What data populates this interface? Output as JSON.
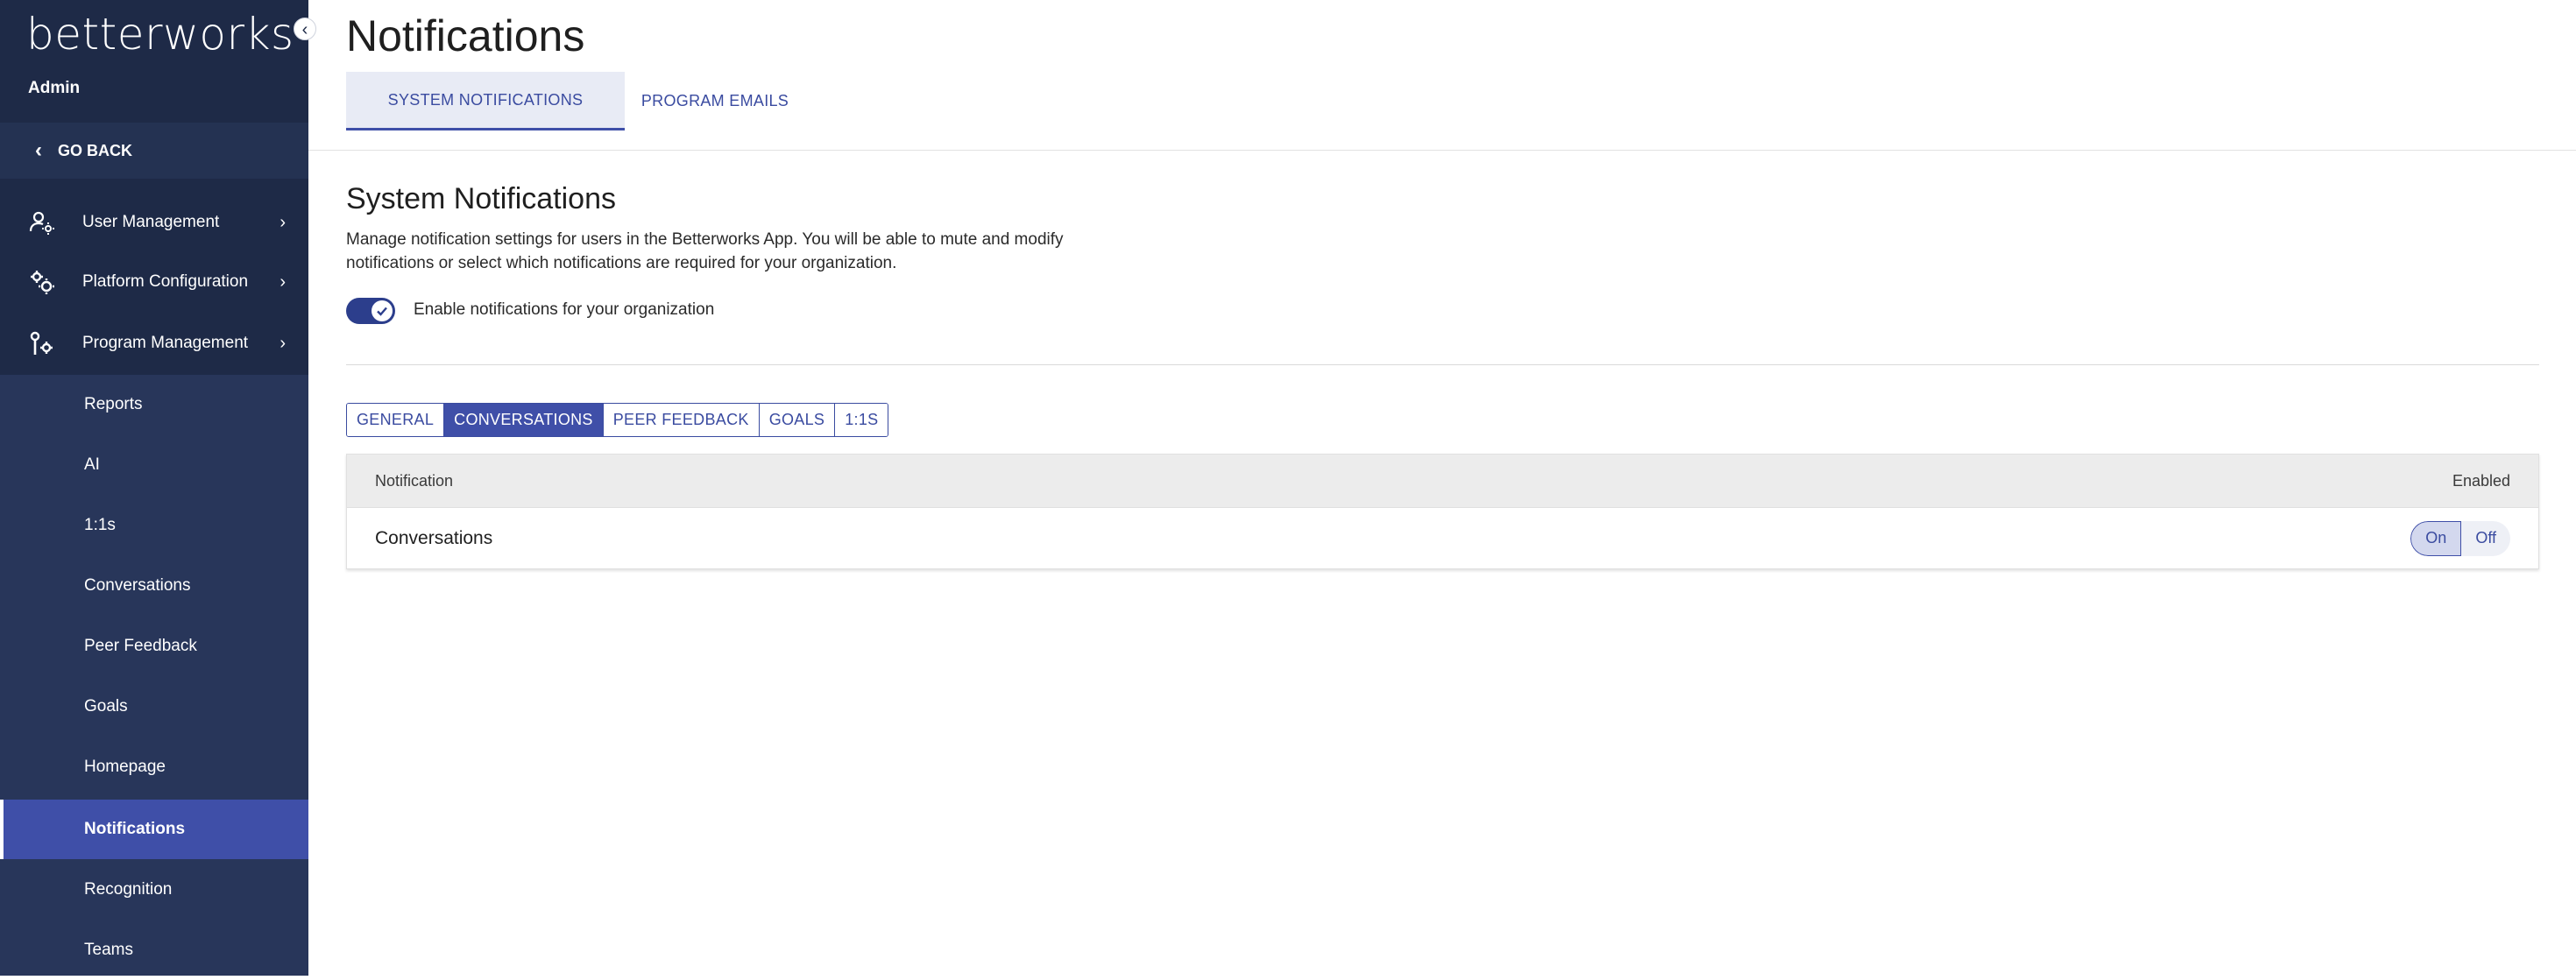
{
  "brand": {
    "logo_text": "betterworks"
  },
  "sidebar": {
    "role_label": "Admin",
    "go_back_label": "GO BACK",
    "sections": [
      {
        "label": "User Management",
        "icon": "user-settings-icon"
      },
      {
        "label": "Platform Configuration",
        "icon": "gears-icon"
      },
      {
        "label": "Program Management",
        "icon": "program-tools-icon"
      }
    ],
    "sub_items": [
      {
        "label": "Reports"
      },
      {
        "label": "AI"
      },
      {
        "label": "1:1s"
      },
      {
        "label": "Conversations"
      },
      {
        "label": "Peer Feedback"
      },
      {
        "label": "Goals"
      },
      {
        "label": "Homepage"
      },
      {
        "label": "Notifications",
        "active": true
      },
      {
        "label": "Recognition"
      },
      {
        "label": "Teams"
      }
    ]
  },
  "header": {
    "title": "Notifications",
    "tabs": [
      {
        "label": "SYSTEM NOTIFICATIONS",
        "active": true
      },
      {
        "label": "PROGRAM EMAILS",
        "active": false
      }
    ]
  },
  "content": {
    "section_title": "System Notifications",
    "description": "Manage notification settings for users in the Betterworks App. You will be able to mute and modify notifications or select which notifications are required for your organization.",
    "org_toggle": {
      "label": "Enable notifications for your organization",
      "enabled": true
    },
    "category_tabs": [
      {
        "label": "GENERAL",
        "active": false
      },
      {
        "label": "CONVERSATIONS",
        "active": true
      },
      {
        "label": "PEER FEEDBACK",
        "active": false
      },
      {
        "label": "GOALS",
        "active": false
      },
      {
        "label": "1:1S",
        "active": false
      }
    ],
    "table": {
      "col_notification": "Notification",
      "col_enabled": "Enabled",
      "rows": [
        {
          "label": "Conversations",
          "on_label": "On",
          "off_label": "Off",
          "value": "On"
        }
      ]
    }
  },
  "colors": {
    "sidebar_bg": "#1e2a47",
    "sub_panel_bg": "#28365a",
    "accent": "#3f4fa8",
    "link_text": "#3a4ba0"
  }
}
